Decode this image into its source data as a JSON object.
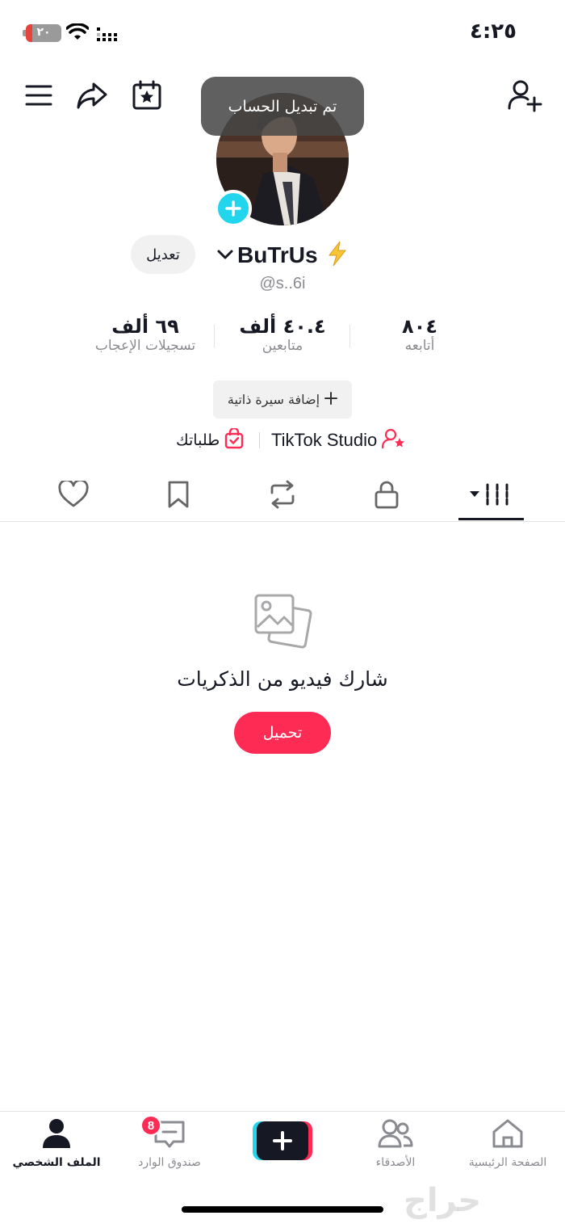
{
  "status_bar": {
    "time": "٤:٢٥",
    "battery": "٢٠"
  },
  "toast": {
    "text": "تم تبديل الحساب"
  },
  "profile": {
    "name": "BuTrUs",
    "handle": "@s..6i",
    "edit_label": "تعديل",
    "stats": {
      "following": {
        "value": "٨٠٤",
        "label": "أتابعه"
      },
      "followers": {
        "value": "٤٠.٤ ألف",
        "label": "متابعين"
      },
      "likes": {
        "value": "٦٩ ألف",
        "label": "تسجيلات الإعجاب"
      }
    },
    "add_bio_label": "إضافة سيرة ذاتية",
    "tiktok_studio_label": "TikTok Studio",
    "orders_label": "طلباتك"
  },
  "empty_state": {
    "title": "شارك فيديو من الذكريات",
    "button": "تحميل"
  },
  "bottom_nav": {
    "home": "الصفحة الرئيسية",
    "friends": "الأصدقاء",
    "inbox": "صندوق الوارد",
    "inbox_badge": "8",
    "profile": "الملف الشخصي"
  },
  "watermark": "حراج",
  "colors": {
    "accent": "#fe2c55",
    "cyan": "#20d5ec",
    "text": "#161823",
    "muted": "#8a8b91"
  }
}
